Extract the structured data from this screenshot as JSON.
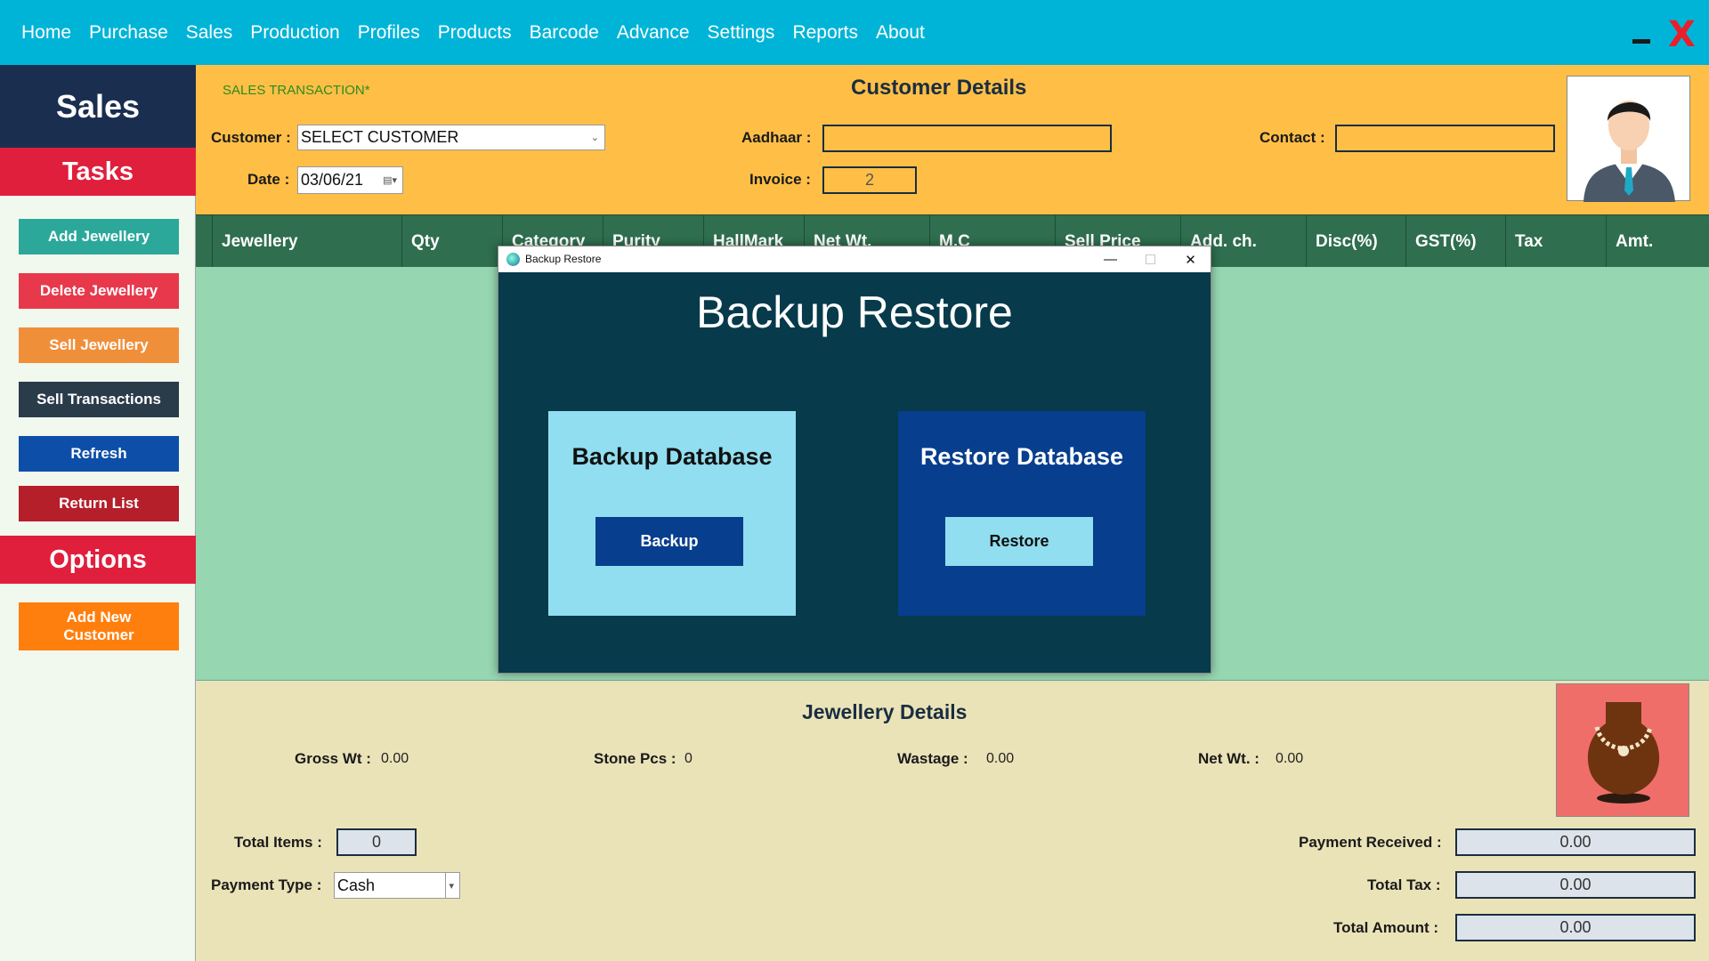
{
  "nav": {
    "items": [
      "Home",
      "Purchase",
      "Sales",
      "Production",
      "Profiles",
      "Products",
      "Barcode",
      "Advance",
      "Settings",
      "Reports",
      "About"
    ],
    "minimize": "_",
    "close": "X"
  },
  "sidebar": {
    "title": "Sales",
    "tasks_heading": "Tasks",
    "tasks": [
      {
        "label": "Add Jewellery",
        "color": "#2ba89a"
      },
      {
        "label": "Delete Jewellery",
        "color": "#e8394c"
      },
      {
        "label": "Sell Jewellery",
        "color": "#f08f3a"
      },
      {
        "label": "Sell Transactions",
        "color": "#2a3b4a"
      },
      {
        "label": "Refresh",
        "color": "#0d4fa8"
      },
      {
        "label": "Return List",
        "color": "#b41f2a"
      }
    ],
    "options_heading": "Options",
    "options": [
      {
        "label": "Add New Customer",
        "color": "#ff7f0e"
      }
    ]
  },
  "customer": {
    "transaction_label": "SALES TRANSACTION*",
    "title": "Customer Details",
    "customer_label": "Customer :",
    "customer_value": "SELECT CUSTOMER",
    "date_label": "Date :",
    "date_value": "03/06/21",
    "aadhaar_label": "Aadhaar :",
    "aadhaar_value": "",
    "invoice_label": "Invoice :",
    "invoice_value": "2",
    "contact_label": "Contact :",
    "contact_value": ""
  },
  "table": {
    "columns": [
      "Jewellery",
      "Qty",
      "Category",
      "Purity",
      "HallMark",
      "Net Wt.",
      "M.C",
      "Sell Price",
      "Add. ch.",
      "Disc(%)",
      "GST(%)",
      "Tax",
      "Amt."
    ]
  },
  "details": {
    "title": "Jewellery Details",
    "gross_wt_label": "Gross Wt :",
    "gross_wt": "0.00",
    "stone_pcs_label": "Stone Pcs :",
    "stone_pcs": "0",
    "wastage_label": "Wastage :",
    "wastage": "0.00",
    "net_wt_label": "Net Wt. :",
    "net_wt": "0.00",
    "total_items_label": "Total Items :",
    "total_items": "0",
    "payment_type_label": "Payment Type :",
    "payment_type": "Cash",
    "payment_received_label": "Payment Received :",
    "payment_received": "0.00",
    "total_tax_label": "Total Tax :",
    "total_tax": "0.00",
    "total_amount_label": "Total Amount :",
    "total_amount": "0.00"
  },
  "dialog": {
    "window_title": "Backup Restore",
    "heading": "Backup Restore",
    "backup_title": "Backup Database",
    "backup_button": "Backup",
    "restore_title": "Restore Database",
    "restore_button": "Restore"
  }
}
